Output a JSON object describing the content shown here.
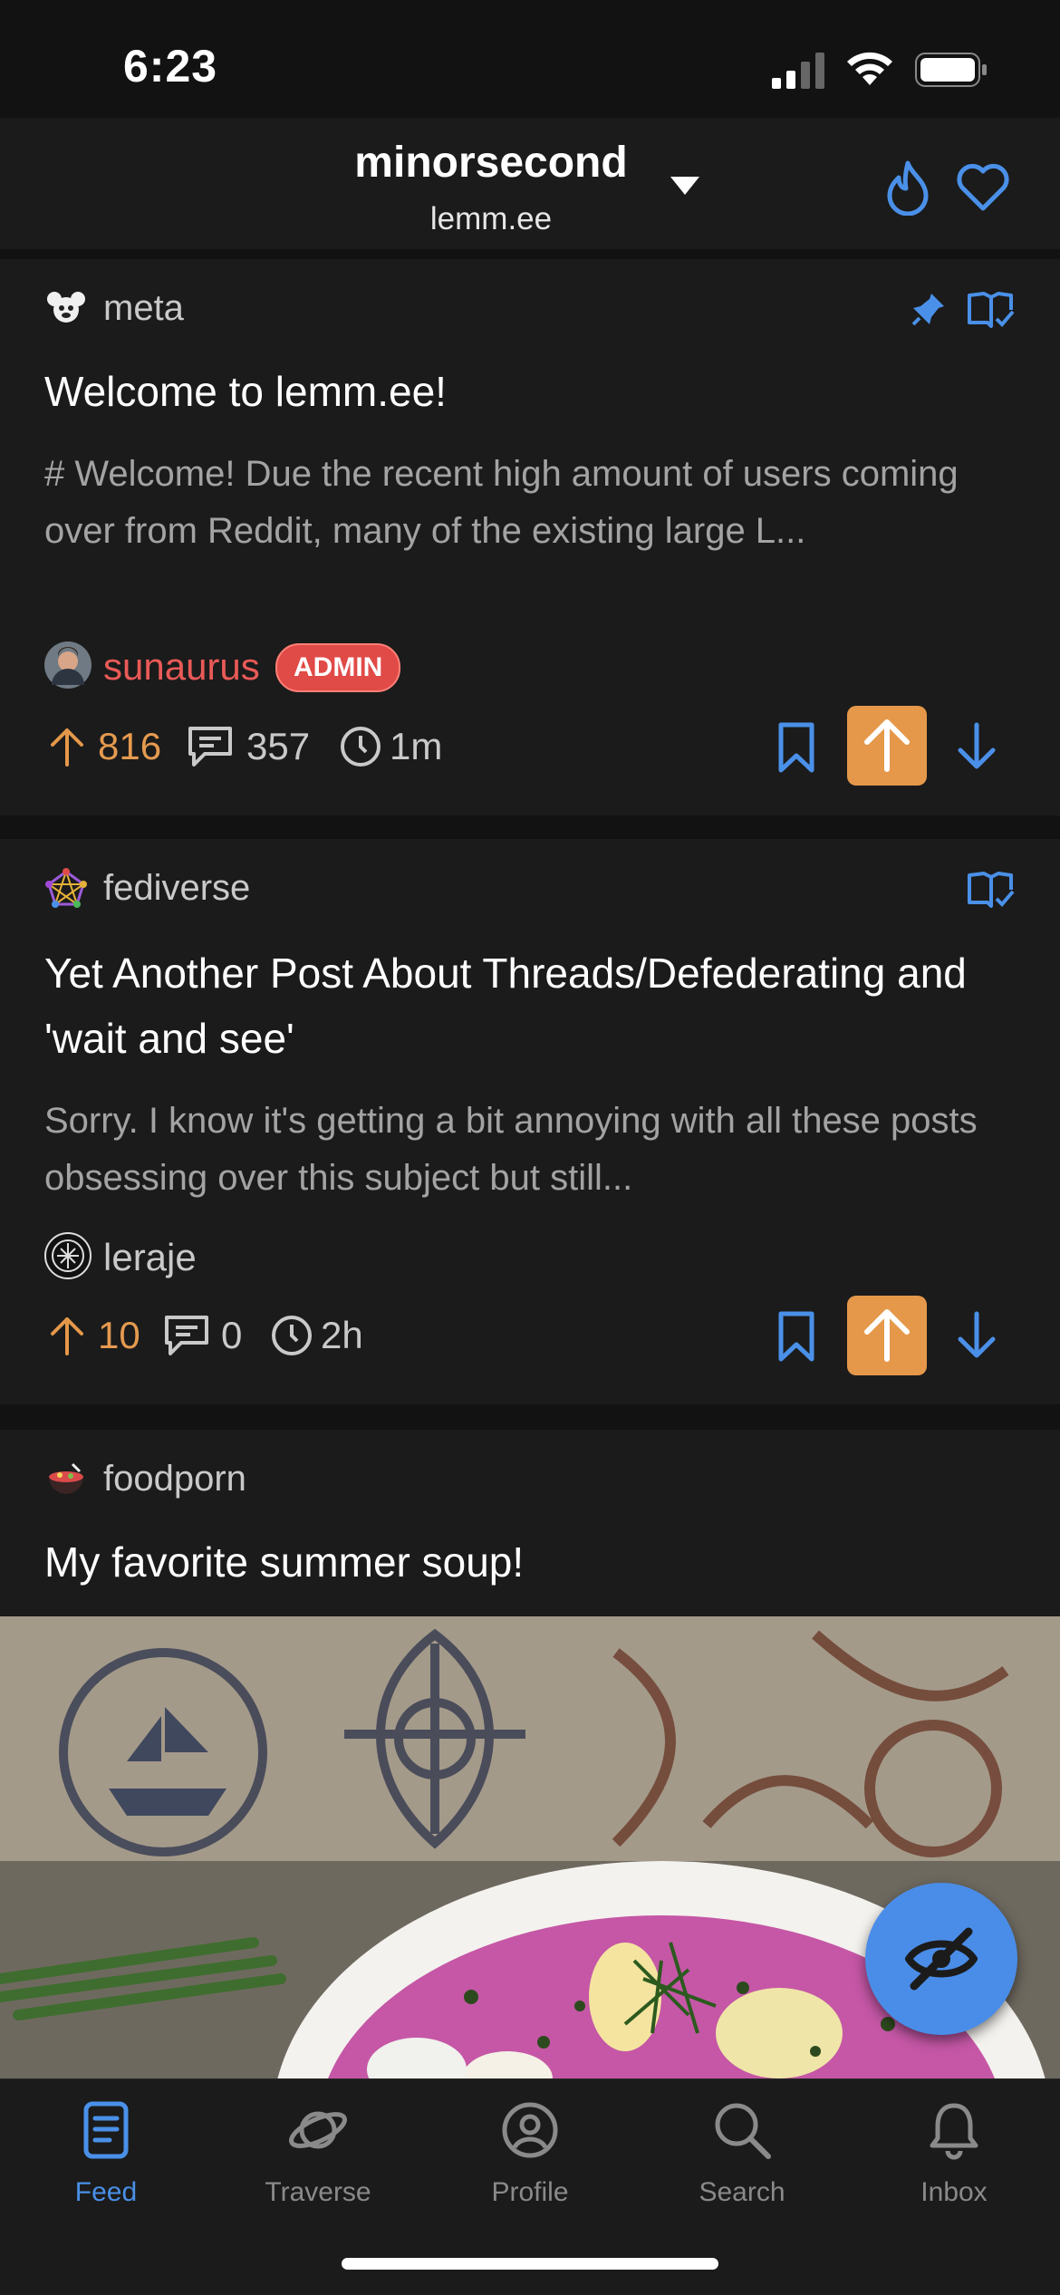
{
  "status_bar": {
    "time": "6:23"
  },
  "header": {
    "account_name": "minorsecond",
    "instance": "lemm.ee",
    "dropdown_icon": "caret-down-icon",
    "sort_icon": "flame-icon",
    "favorites_icon": "heart-icon"
  },
  "colors": {
    "accent": "#4a90e8",
    "upvote": "#e5984a",
    "admin": "#e04a47",
    "background": "#121212",
    "card": "#1b1b1b"
  },
  "posts": [
    {
      "community": "meta",
      "title": "Welcome to lemm.ee!",
      "body": "# Welcome! Due the recent high amount of users coming over from Reddit, many of the existing large L...",
      "author": "sunaurus",
      "author_badge": "ADMIN",
      "upvotes": "816",
      "comments": "357",
      "age": "1m",
      "pinned": true
    },
    {
      "community": "fediverse",
      "title": "Yet Another Post About Threads/Defederating and 'wait and see'",
      "body": "Sorry. I know it's getting a bit annoying with all these posts obsessing over this subject but still...",
      "author": "leraje",
      "upvotes": "10",
      "comments": "0",
      "age": "2h"
    },
    {
      "community": "foodporn",
      "title": "My favorite summer soup!"
    }
  ],
  "tabs": [
    {
      "label": "Feed",
      "icon": "document-icon",
      "active": true
    },
    {
      "label": "Traverse",
      "icon": "planet-icon"
    },
    {
      "label": "Profile",
      "icon": "user-circle-icon"
    },
    {
      "label": "Search",
      "icon": "search-icon"
    },
    {
      "label": "Inbox",
      "icon": "bell-icon"
    }
  ]
}
